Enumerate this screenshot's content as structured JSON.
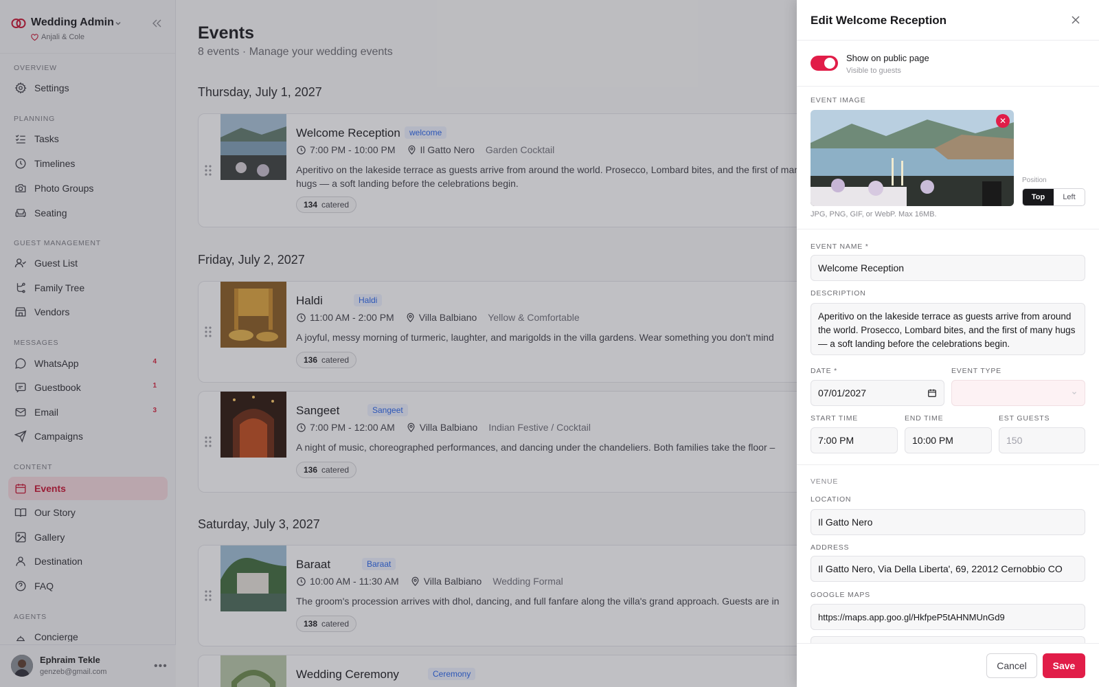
{
  "sidebar": {
    "app_name": "Wedding Admin",
    "couple": "Anjali & Cole",
    "sections": {
      "overview": "OVERVIEW",
      "planning": "PLANNING",
      "guest_management": "GUEST MANAGEMENT",
      "messages": "MESSAGES",
      "content": "CONTENT",
      "agents": "AGENTS"
    },
    "items": {
      "settings": "Settings",
      "tasks": "Tasks",
      "timelines": "Timelines",
      "photo_groups": "Photo Groups",
      "seating": "Seating",
      "guest_list": "Guest List",
      "family_tree": "Family Tree",
      "vendors": "Vendors",
      "whatsapp": "WhatsApp",
      "guestbook": "Guestbook",
      "email": "Email",
      "campaigns": "Campaigns",
      "events": "Events",
      "our_story": "Our Story",
      "gallery": "Gallery",
      "destination": "Destination",
      "faq": "FAQ",
      "concierge": "Concierge"
    },
    "badges": {
      "whatsapp": "4",
      "guestbook": "1",
      "email": "3"
    },
    "user": {
      "name": "Ephraim Tekle",
      "email": "genzeb@gmail.com"
    }
  },
  "main": {
    "title": "Events",
    "subtitle": "8 events · Manage your wedding events",
    "days": [
      "Thursday, July 1, 2027",
      "Friday, July 2, 2027",
      "Saturday, July 3, 2027"
    ],
    "events": [
      {
        "title": "Welcome Reception",
        "tag": "welcome",
        "time": "7:00 PM - 10:00 PM",
        "location": "Il Gatto Nero",
        "dress": "Garden Cocktail",
        "description": "Aperitivo on the lakeside terrace as guests arrive from around the world. Prosecco, Lombard bites, and the first of many hugs — a soft landing before the celebrations begin.",
        "count": "134",
        "count_label": "catered"
      },
      {
        "title": "Haldi",
        "tag": "Haldi",
        "time": "11:00 AM - 2:00 PM",
        "location": "Villa Balbiano",
        "dress": "Yellow & Comfortable",
        "description": "A joyful, messy morning of turmeric, laughter, and marigolds in the villa gardens. Wear something you don't mind",
        "count": "136",
        "count_label": "catered"
      },
      {
        "title": "Sangeet",
        "tag": "Sangeet",
        "time": "7:00 PM - 12:00 AM",
        "location": "Villa Balbiano",
        "dress": "Indian Festive / Cocktail",
        "description": "A night of music, choreographed performances, and dancing under the chandeliers. Both families take the floor –",
        "count": "136",
        "count_label": "catered"
      },
      {
        "title": "Baraat",
        "tag": "Baraat",
        "time": "10:00 AM - 11:30 AM",
        "location": "Villa Balbiano",
        "dress": "Wedding Formal",
        "description": "The groom's procession arrives with dhol, dancing, and full fanfare along the villa's grand approach. Guests are in",
        "count": "138",
        "count_label": "catered"
      },
      {
        "title": "Wedding Ceremony",
        "tag": "Ceremony"
      }
    ]
  },
  "panel": {
    "title": "Edit Welcome Reception",
    "toggle_label": "Show on public page",
    "toggle_sub": "Visible to guests",
    "image_label": "EVENT IMAGE",
    "image_hint": "JPG, PNG, GIF, or WebP. Max 16MB.",
    "position_label": "Position",
    "position_options": [
      "Top",
      "Left"
    ],
    "name_label": "EVENT NAME *",
    "name_value": "Welcome Reception",
    "desc_label": "DESCRIPTION",
    "desc_value": "Aperitivo on the lakeside terrace as guests arrive from around the world. Prosecco, Lombard bites, and the first of many hugs — a soft landing before the celebrations begin.",
    "date_label": "DATE *",
    "date_value": "07/01/2027",
    "type_label": "EVENT TYPE",
    "start_label": "START TIME",
    "start_value": "7:00 PM",
    "end_label": "END TIME",
    "end_value": "10:00 PM",
    "guests_label": "EST GUESTS",
    "guests_placeholder": "150",
    "venue_label": "VENUE",
    "location_label": "LOCATION",
    "location_value": "Il Gatto Nero",
    "address_label": "ADDRESS",
    "address_value": "Il Gatto Nero, Via Della Liberta', 69, 22012 Cernobbio CO",
    "maps_label": "GOOGLE MAPS",
    "maps_value": "https://maps.app.goo.gl/HkfpeP5tAHNMUnGd9",
    "cancel": "Cancel",
    "save": "Save"
  },
  "colors": {
    "accent": "#e11d48",
    "active_bg": "#f7d9de"
  }
}
